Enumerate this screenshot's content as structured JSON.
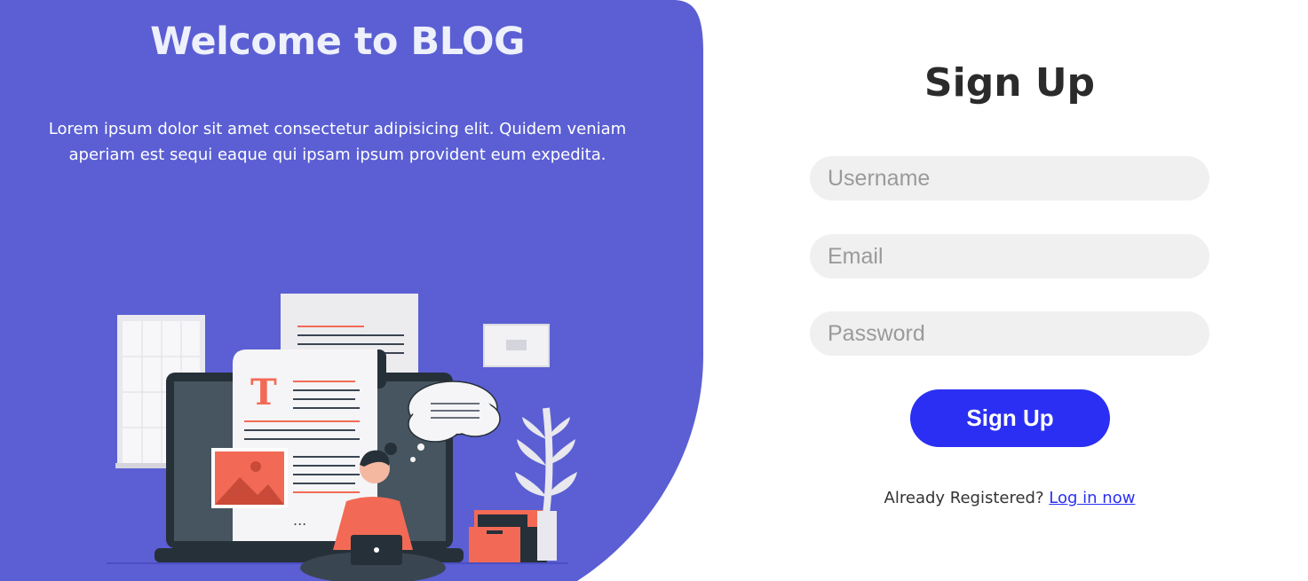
{
  "hero": {
    "title": "Welcome to BLOG",
    "description": "Lorem ipsum dolor sit amet consectetur adipisicing elit. Quidem veniam aperiam est sequi eaque qui ipsam ipsum provident eum expedita.",
    "illustration_letter": "T",
    "illustration_ellipsis": "..."
  },
  "signup": {
    "title": "Sign Up",
    "fields": {
      "username": {
        "placeholder": "Username",
        "value": ""
      },
      "email": {
        "placeholder": "Email",
        "value": ""
      },
      "password": {
        "placeholder": "Password",
        "value": ""
      }
    },
    "button_label": "Sign Up",
    "already_text": "Already Registered?",
    "login_link": "Log in now"
  },
  "colors": {
    "panel": "#5b5fd3",
    "button": "#2b2ff3",
    "accent_illustration": "#f26a55"
  }
}
